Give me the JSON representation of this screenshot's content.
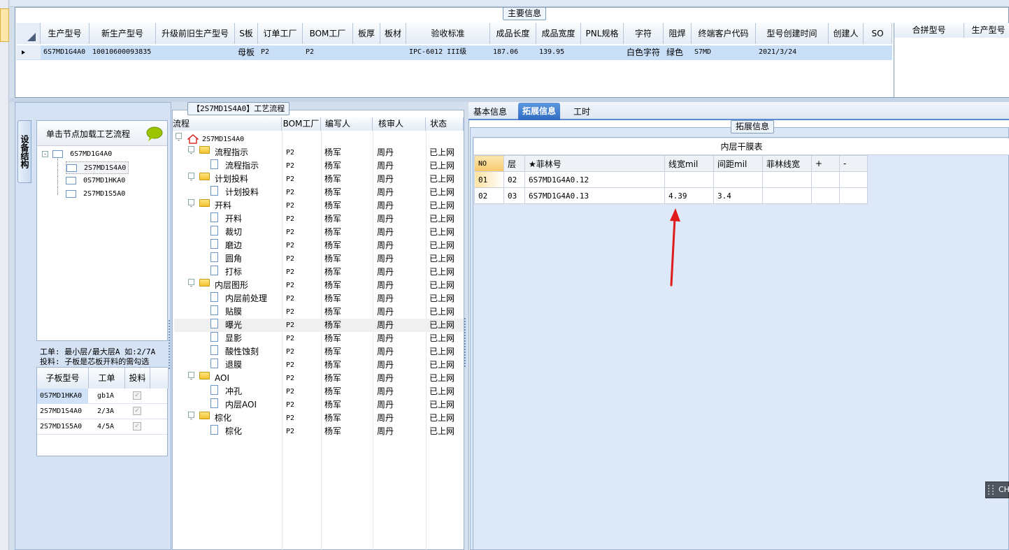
{
  "main_info": {
    "caption": "主要信息",
    "columns": [
      "生产型号",
      "新生产型号",
      "升级前旧生产型号",
      "S板",
      "订单工厂",
      "BOM工厂",
      "板厚",
      "板材",
      "验收标准",
      "成品长度",
      "成品宽度",
      "PNL规格",
      "字符",
      "阻焊",
      "终端客户代码",
      "型号创建时间",
      "创建人",
      "SO"
    ],
    "row": {
      "prod_model": "6S7MD1G4A0",
      "new_model": "10010600093835",
      "old_model": "",
      "s_board": "母板",
      "order_factory": "P2",
      "bom_factory": "P2",
      "thickness": "",
      "material": "",
      "standard": "IPC-6012 III级",
      "length": "187.06",
      "width": "139.95",
      "pnl": "",
      "char": "白色字符",
      "solder": "绿色",
      "customer": "S7MD",
      "created": "2021/3/24",
      "creator": "",
      "so": ""
    },
    "side_columns": [
      "合拼型号",
      "生产型号"
    ]
  },
  "flow_caption": "【2S7MD1S4A0】工艺流程",
  "left_panel": {
    "vtab": "设备结构",
    "banner": "单击节点加载工艺流程",
    "tree": {
      "root": "6S7MD1G4A0",
      "children": [
        "2S7MD1S4A0",
        "0S7MD1HKA0",
        "2S7MD1S5A0"
      ]
    },
    "note1": "工单: 最小层/最大层A 如:2/7A",
    "note2": "投料: 子板是芯板开料的需勾选",
    "sub_columns": [
      "子板型号",
      "工单",
      "投料"
    ],
    "sub_rows": [
      {
        "model": "0S7MD1HKA0",
        "order": "gb1A",
        "feed": "✓"
      },
      {
        "model": "2S7MD1S4A0",
        "order": "2/3A",
        "feed": "✓"
      },
      {
        "model": "2S7MD1S5A0",
        "order": "4/5A",
        "feed": "✓"
      }
    ]
  },
  "flow": {
    "columns": [
      "流程",
      "BOM工厂",
      "编写人",
      "核审人",
      "状态"
    ],
    "root": "2S7MD1S4A0",
    "rows": [
      {
        "name": "流程指示",
        "folder": true,
        "bom": "P2",
        "writer": "杨军",
        "reviewer": "周丹",
        "status": "已上网"
      },
      {
        "name": "流程指示",
        "folder": false,
        "bom": "P2",
        "writer": "杨军",
        "reviewer": "周丹",
        "status": "已上网"
      },
      {
        "name": "计划投料",
        "folder": true,
        "bom": "P2",
        "writer": "杨军",
        "reviewer": "周丹",
        "status": "已上网"
      },
      {
        "name": "计划投料",
        "folder": false,
        "bom": "P2",
        "writer": "杨军",
        "reviewer": "周丹",
        "status": "已上网"
      },
      {
        "name": "开料",
        "folder": true,
        "bom": "P2",
        "writer": "杨军",
        "reviewer": "周丹",
        "status": "已上网"
      },
      {
        "name": "开料",
        "folder": false,
        "bom": "P2",
        "writer": "杨军",
        "reviewer": "周丹",
        "status": "已上网"
      },
      {
        "name": "裁切",
        "folder": false,
        "bom": "P2",
        "writer": "杨军",
        "reviewer": "周丹",
        "status": "已上网"
      },
      {
        "name": "磨边",
        "folder": false,
        "bom": "P2",
        "writer": "杨军",
        "reviewer": "周丹",
        "status": "已上网"
      },
      {
        "name": "圆角",
        "folder": false,
        "bom": "P2",
        "writer": "杨军",
        "reviewer": "周丹",
        "status": "已上网"
      },
      {
        "name": "打标",
        "folder": false,
        "bom": "P2",
        "writer": "杨军",
        "reviewer": "周丹",
        "status": "已上网"
      },
      {
        "name": "内层图形",
        "folder": true,
        "bom": "P2",
        "writer": "杨军",
        "reviewer": "周丹",
        "status": "已上网"
      },
      {
        "name": "内层前处理",
        "folder": false,
        "bom": "P2",
        "writer": "杨军",
        "reviewer": "周丹",
        "status": "已上网"
      },
      {
        "name": "贴膜",
        "folder": false,
        "bom": "P2",
        "writer": "杨军",
        "reviewer": "周丹",
        "status": "已上网"
      },
      {
        "name": "曝光",
        "folder": false,
        "bom": "P2",
        "writer": "杨军",
        "reviewer": "周丹",
        "status": "已上网"
      },
      {
        "name": "显影",
        "folder": false,
        "bom": "P2",
        "writer": "杨军",
        "reviewer": "周丹",
        "status": "已上网"
      },
      {
        "name": "酸性蚀刻",
        "folder": false,
        "bom": "P2",
        "writer": "杨军",
        "reviewer": "周丹",
        "status": "已上网"
      },
      {
        "name": "退膜",
        "folder": false,
        "bom": "P2",
        "writer": "杨军",
        "reviewer": "周丹",
        "status": "已上网"
      },
      {
        "name": "AOI",
        "folder": true,
        "bom": "P2",
        "writer": "杨军",
        "reviewer": "周丹",
        "status": "已上网"
      },
      {
        "name": "冲孔",
        "folder": false,
        "bom": "P2",
        "writer": "杨军",
        "reviewer": "周丹",
        "status": "已上网"
      },
      {
        "name": "内层AOI",
        "folder": false,
        "bom": "P2",
        "writer": "杨军",
        "reviewer": "周丹",
        "status": "已上网"
      },
      {
        "name": "棕化",
        "folder": true,
        "bom": "P2",
        "writer": "杨军",
        "reviewer": "周丹",
        "status": "已上网"
      },
      {
        "name": "棕化",
        "folder": false,
        "bom": "P2",
        "writer": "杨军",
        "reviewer": "周丹",
        "status": "已上网"
      }
    ]
  },
  "tabs": [
    "基本信息",
    "拓展信息",
    "工时"
  ],
  "ext": {
    "caption": "拓展信息",
    "table_title": "内层干膜表",
    "columns": [
      "NO",
      "层",
      "★菲林号",
      "线宽mil",
      "间距mil",
      "菲林线宽",
      "+",
      "-"
    ],
    "rows": [
      [
        "01",
        "02",
        "6S7MD1G4A0.12",
        "",
        "",
        "",
        "",
        ""
      ],
      [
        "02",
        "03",
        "6S7MD1G4A0.13",
        "4.39",
        "3.4",
        "",
        "",
        ""
      ]
    ]
  },
  "corner_badge": "CH"
}
